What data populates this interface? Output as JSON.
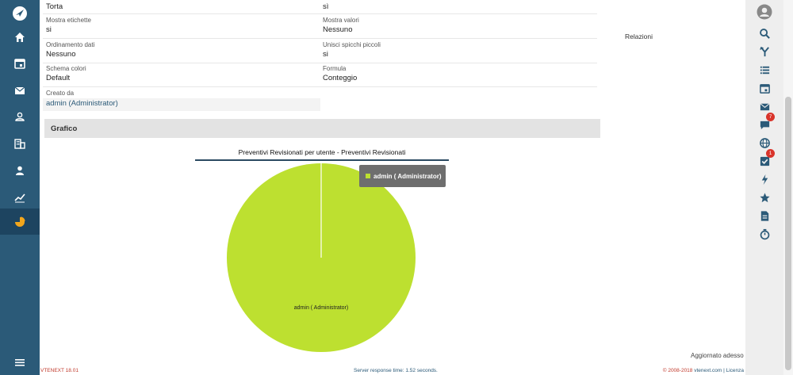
{
  "fields": {
    "tipo_value": "Torta",
    "other_value": "sì",
    "mostra_etichette": {
      "label": "Mostra etichette",
      "value": "si"
    },
    "mostra_valori": {
      "label": "Mostra valori",
      "value": "Nessuno"
    },
    "ordinamento": {
      "label": "Ordinamento dati",
      "value": "Nessuno"
    },
    "unisci": {
      "label": "Unisci spicchi piccoli",
      "value": "si"
    },
    "schema": {
      "label": "Schema colori",
      "value": "Default"
    },
    "formula": {
      "label": "Formula",
      "value": "Conteggio"
    },
    "creato": {
      "label": "Creato da",
      "value": "admin (Administrator)"
    }
  },
  "section": {
    "title": "Grafico"
  },
  "relazioni": "Relazioni",
  "chart_data": {
    "type": "pie",
    "title": "Preventivi Revisionati per utente - Preventivi Revisionati",
    "categories": [
      "admin ( Administrator)"
    ],
    "values": [
      100
    ],
    "legend": [
      "admin ( Administrator)"
    ],
    "legend_placement": "top-right",
    "slice_label": "admin ( Administrator)",
    "colors": [
      "#bde030"
    ]
  },
  "aggiornato": "Aggiornato adesso",
  "footer": {
    "version": "VTENEXT 18.01",
    "response": "Server response time: 1.52 seconds.",
    "copyright": "© 2008-2018",
    "site": "vtenext.com",
    "sep": " | ",
    "licenza": "Licenza"
  },
  "badges": {
    "messages": "7",
    "tasks": "1"
  },
  "colors": {
    "sidebar": "#2b5a78",
    "accent": "#f2a61c",
    "pie": "#bde030",
    "badge": "#d9342b"
  }
}
